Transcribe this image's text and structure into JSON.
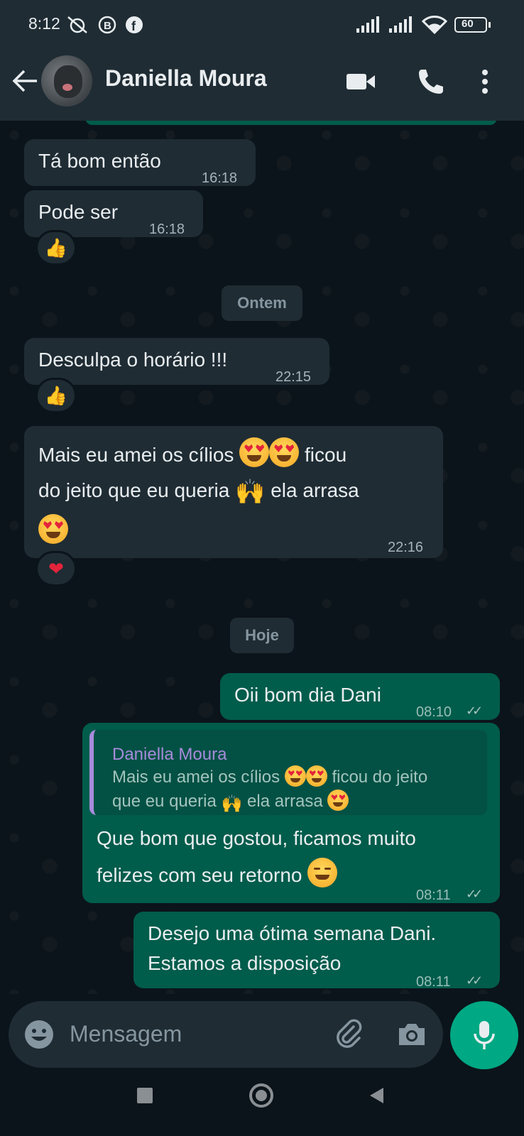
{
  "status_bar": {
    "time": "8:12",
    "battery": "60"
  },
  "header": {
    "contact_name": "Daniella Moura"
  },
  "messages": [
    {
      "text": "Tá bom então",
      "time": "16:18"
    },
    {
      "text": "Pode ser",
      "time": "16:18",
      "reaction": "thumbs-up"
    },
    {
      "date_chip": "Ontem"
    },
    {
      "text": "Desculpa o horário !!!",
      "time": "22:15",
      "reaction": "thumbs-up"
    },
    {
      "text_line1": "Mais eu amei os cílios",
      "text_line1b": "ficou",
      "text_line2": "do jeito que eu queria",
      "text_line2b": "ela arrasa",
      "time": "22:16",
      "reaction": "red-heart"
    },
    {
      "date_chip": "Hoje"
    },
    {
      "text": "Oii bom dia Dani",
      "time": "08:10"
    },
    {
      "quote_name": "Daniella Moura",
      "quote_line1a": "Mais eu amei os cílios",
      "quote_line1b": "ficou do jeito",
      "quote_line2a": "que eu queria",
      "quote_line2b": "ela arrasa",
      "text_line1": "Que bom que gostou, ficamos muito",
      "text_line2": "felizes com seu retorno",
      "time": "08:11"
    },
    {
      "text_line1": "Desejo uma ótima semana Dani.",
      "text_line2": "Estamos a disposição",
      "time": "08:11"
    }
  ],
  "input": {
    "placeholder": "Mensagem"
  },
  "colors": {
    "incoming_bubble": "#1f2c34",
    "outgoing_bubble": "#005c4b",
    "accent": "#00a884",
    "quote_name": "#a78bdb"
  }
}
